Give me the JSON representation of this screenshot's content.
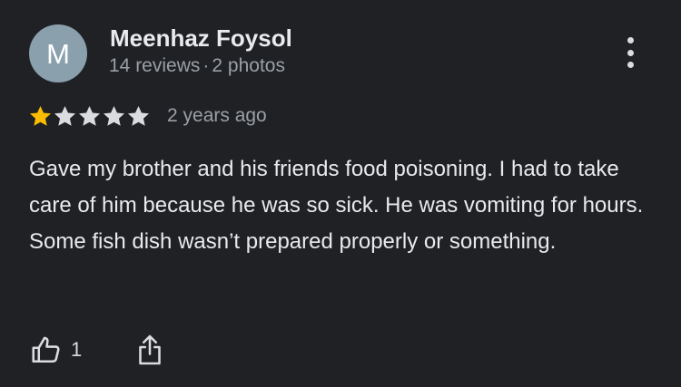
{
  "reviewer": {
    "avatar_letter": "M",
    "name": "Meenhaz Foysol",
    "reviews": "14 reviews",
    "separator": "·",
    "photos": "2 photos"
  },
  "review": {
    "rating": 1,
    "max_rating": 5,
    "date": "2 years ago",
    "text": "Gave my brother and his friends food poisoning. I had to take care of him because he was so sick. He was vomiting for hours. Some fish dish wasn’t prepared properly or something."
  },
  "actions": {
    "like_count": "1",
    "like_icon": "thumbs-up-icon",
    "share_icon": "share-icon",
    "more_icon": "more-vert-icon"
  },
  "colors": {
    "background": "#202124",
    "star_filled": "#fbbc04",
    "star_empty": "#dadce0",
    "avatar_bg": "#8aa0ad",
    "text_primary": "#e8eaed",
    "text_secondary": "#9aa0a6"
  }
}
